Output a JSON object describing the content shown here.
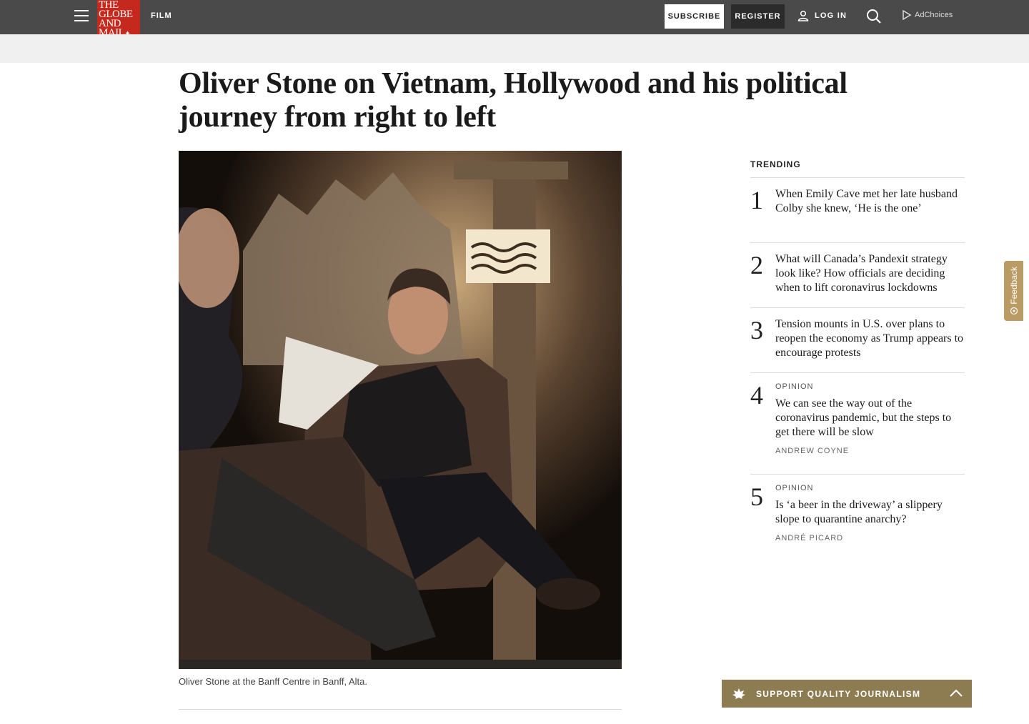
{
  "header": {
    "logo_lines": [
      "THE",
      "GLOBE",
      "AND",
      "MAIL"
    ],
    "section": "FILM",
    "subscribe": "SUBSCRIBE",
    "register": "REGISTER",
    "login": "LOG IN",
    "adchoices": "AdChoices"
  },
  "article": {
    "headline": "Oliver Stone on Vietnam, Hollywood and his political journey from right to left",
    "photo_caption": "Oliver Stone at the Banff Centre in Banff, Alta."
  },
  "trending": {
    "title": "TRENDING",
    "items": [
      {
        "num": "1",
        "label": "",
        "text": "When Emily Cave met her late husband Colby she knew, ‘He is the one’",
        "author": ""
      },
      {
        "num": "2",
        "label": "",
        "text": "What will Canada’s Pandexit strategy look like? How officials are deciding when to lift coronavirus lockdowns",
        "author": ""
      },
      {
        "num": "3",
        "label": "",
        "text": "Tension mounts in U.S. over plans to reopen the economy as Trump appears to encourage protests",
        "author": ""
      },
      {
        "num": "4",
        "label": "OPINION",
        "text": "We can see the way out of the coronavirus pandemic, but the steps to get there will be slow",
        "author": "ANDREW COYNE"
      },
      {
        "num": "5",
        "label": "OPINION",
        "text": "Is ‘a beer in the driveway’ a slippery slope to quarantine anarchy?",
        "author": "ANDRÉ PICARD"
      }
    ]
  },
  "feedback": "Feedback",
  "support": {
    "label": "SUPPORT QUALITY JOURNALISM"
  },
  "colors": {
    "topbar": "#4a4a4a",
    "logo": "#c5281c",
    "support": "#8d7c52",
    "feedback": "#b99b63"
  }
}
